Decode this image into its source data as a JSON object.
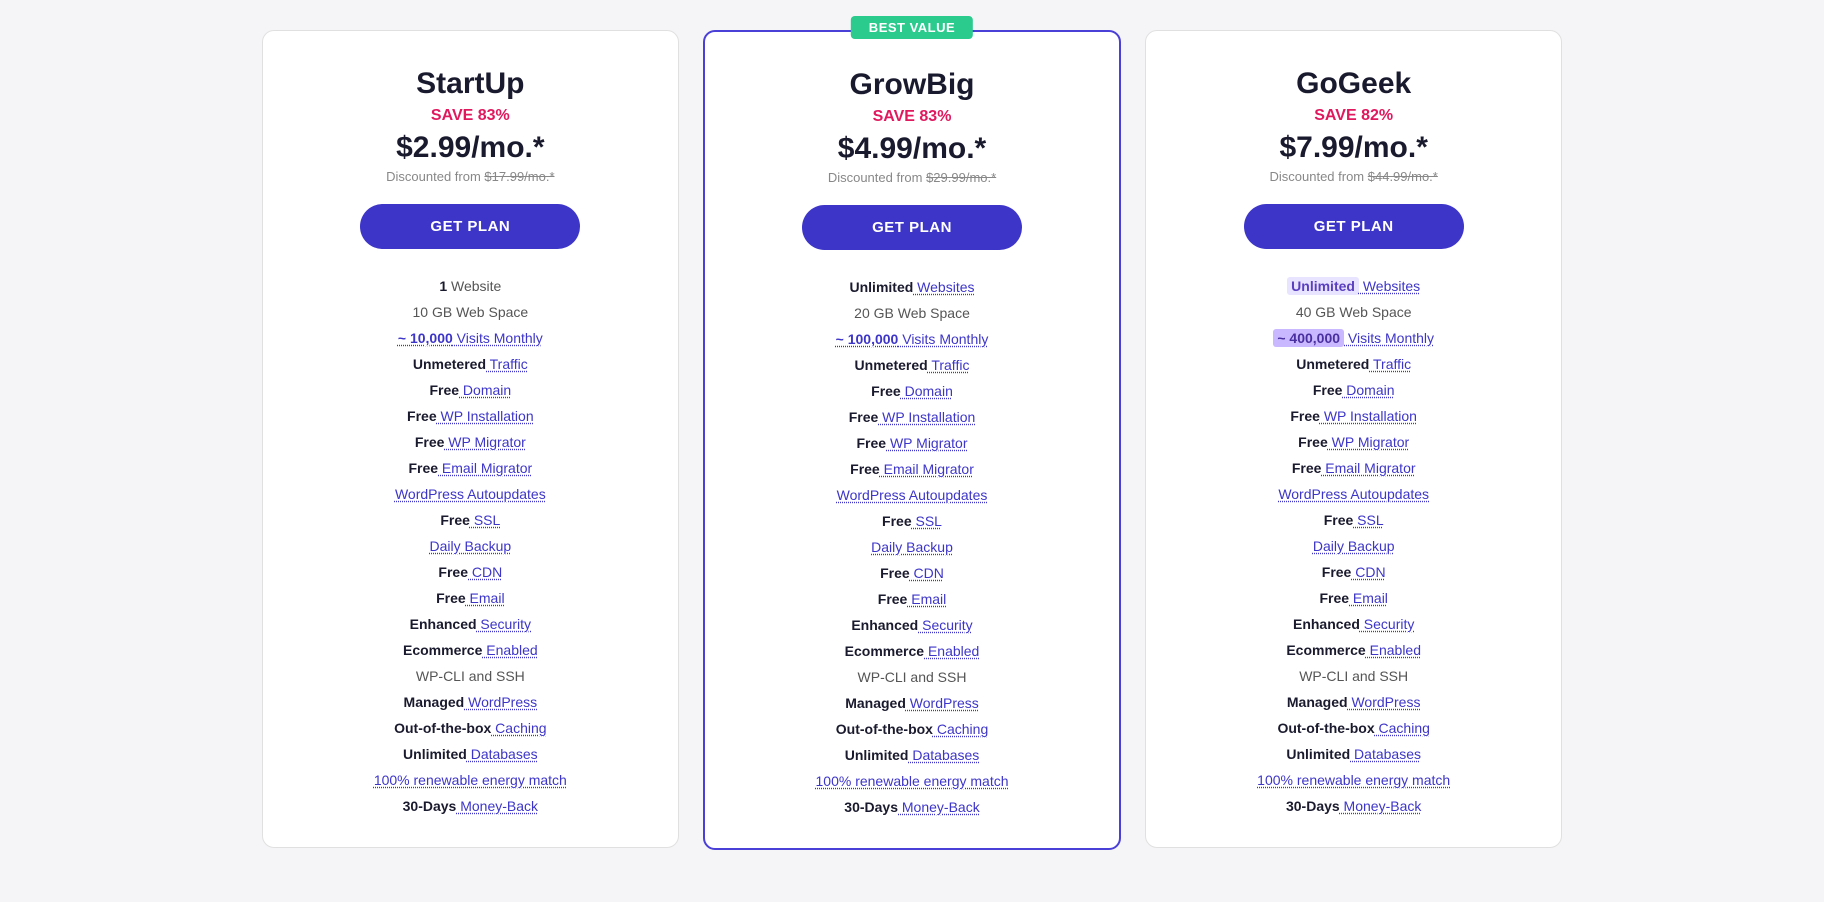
{
  "plans": [
    {
      "id": "startup",
      "name": "StartUp",
      "save": "SAVE 83%",
      "price": "$2.99/mo.*",
      "originalLabel": "Discounted from",
      "originalPrice": "$17.99/mo.*",
      "cta": "GET PLAN",
      "featured": false,
      "features": [
        {
          "bold": "1",
          "rest": " Website",
          "type": "normal"
        },
        {
          "bold": "",
          "rest": "10 GB Web Space",
          "type": "normal"
        },
        {
          "bold": "~ 10,000",
          "rest": " Visits Monthly",
          "type": "link-rest"
        },
        {
          "bold": "Unmetered",
          "rest": " Traffic",
          "type": "bold-link"
        },
        {
          "bold": "Free",
          "rest": " Domain",
          "type": "bold-link"
        },
        {
          "bold": "Free",
          "rest": " WP Installation",
          "type": "bold-link"
        },
        {
          "bold": "Free",
          "rest": " WP Migrator",
          "type": "bold-link"
        },
        {
          "bold": "Free",
          "rest": " Email Migrator",
          "type": "bold-link"
        },
        {
          "bold": "",
          "rest": "WordPress Autoupdates",
          "type": "link-all"
        },
        {
          "bold": "Free",
          "rest": " SSL",
          "type": "bold-link"
        },
        {
          "bold": "",
          "rest": "Daily Backup",
          "type": "link-all"
        },
        {
          "bold": "Free",
          "rest": " CDN",
          "type": "bold-link"
        },
        {
          "bold": "Free",
          "rest": " Email",
          "type": "bold-link"
        },
        {
          "bold": "Enhanced",
          "rest": " Security",
          "type": "bold-link"
        },
        {
          "bold": "Ecommerce",
          "rest": " Enabled",
          "type": "bold-link"
        },
        {
          "bold": "",
          "rest": "WP-CLI and SSH",
          "type": "normal"
        },
        {
          "bold": "Managed",
          "rest": " WordPress",
          "type": "bold-link"
        },
        {
          "bold": "Out-of-the-box",
          "rest": " Caching",
          "type": "bold-link"
        },
        {
          "bold": "Unlimited",
          "rest": " Databases",
          "type": "bold-link"
        },
        {
          "bold": "",
          "rest": "100% renewable energy match",
          "type": "link-all"
        },
        {
          "bold": "30-Days",
          "rest": " Money-Back",
          "type": "bold-link"
        }
      ]
    },
    {
      "id": "growbig",
      "name": "GrowBig",
      "save": "SAVE 83%",
      "price": "$4.99/mo.*",
      "originalLabel": "Discounted from",
      "originalPrice": "$29.99/mo.*",
      "cta": "GET PLAN",
      "featured": true,
      "badgeText": "BEST VALUE",
      "features": [
        {
          "bold": "Unlimited",
          "rest": " Websites",
          "type": "bold-link"
        },
        {
          "bold": "",
          "rest": "20 GB Web Space",
          "type": "normal"
        },
        {
          "bold": "~ 100,000",
          "rest": " Visits Monthly",
          "type": "link-rest"
        },
        {
          "bold": "Unmetered",
          "rest": " Traffic",
          "type": "bold-link"
        },
        {
          "bold": "Free",
          "rest": " Domain",
          "type": "bold-link"
        },
        {
          "bold": "Free",
          "rest": " WP Installation",
          "type": "bold-link"
        },
        {
          "bold": "Free",
          "rest": " WP Migrator",
          "type": "bold-link"
        },
        {
          "bold": "Free",
          "rest": " Email Migrator",
          "type": "bold-link"
        },
        {
          "bold": "",
          "rest": "WordPress Autoupdates",
          "type": "link-all"
        },
        {
          "bold": "Free",
          "rest": " SSL",
          "type": "bold-link"
        },
        {
          "bold": "",
          "rest": "Daily Backup",
          "type": "link-all"
        },
        {
          "bold": "Free",
          "rest": " CDN",
          "type": "bold-link"
        },
        {
          "bold": "Free",
          "rest": " Email",
          "type": "bold-link"
        },
        {
          "bold": "Enhanced",
          "rest": " Security",
          "type": "bold-link"
        },
        {
          "bold": "Ecommerce",
          "rest": " Enabled",
          "type": "bold-link"
        },
        {
          "bold": "",
          "rest": "WP-CLI and SSH",
          "type": "normal"
        },
        {
          "bold": "Managed",
          "rest": " WordPress",
          "type": "bold-link"
        },
        {
          "bold": "Out-of-the-box",
          "rest": " Caching",
          "type": "bold-link"
        },
        {
          "bold": "Unlimited",
          "rest": " Databases",
          "type": "bold-link"
        },
        {
          "bold": "",
          "rest": "100% renewable energy match",
          "type": "link-all"
        },
        {
          "bold": "30-Days",
          "rest": " Money-Back",
          "type": "bold-link"
        }
      ]
    },
    {
      "id": "gogeek",
      "name": "GoGeek",
      "save": "SAVE 82%",
      "price": "$7.99/mo.*",
      "originalLabel": "Discounted from",
      "originalPrice": "$44.99/mo.*",
      "cta": "GET PLAN",
      "featured": false,
      "features": [
        {
          "bold": "Unlimited",
          "rest": " Websites",
          "type": "highlight-bold",
          "highlight": true
        },
        {
          "bold": "",
          "rest": "40 GB Web Space",
          "type": "normal"
        },
        {
          "bold": "~ 400,000",
          "rest": " Visits Monthly",
          "type": "highlight-visits"
        },
        {
          "bold": "Unmetered",
          "rest": " Traffic",
          "type": "bold-link"
        },
        {
          "bold": "Free",
          "rest": " Domain",
          "type": "bold-link"
        },
        {
          "bold": "Free",
          "rest": " WP Installation",
          "type": "bold-link"
        },
        {
          "bold": "Free",
          "rest": " WP Migrator",
          "type": "bold-link"
        },
        {
          "bold": "Free",
          "rest": " Email Migrator",
          "type": "bold-link"
        },
        {
          "bold": "",
          "rest": "WordPress Autoupdates",
          "type": "link-all"
        },
        {
          "bold": "Free",
          "rest": " SSL",
          "type": "bold-link"
        },
        {
          "bold": "",
          "rest": "Daily Backup",
          "type": "link-all"
        },
        {
          "bold": "Free",
          "rest": " CDN",
          "type": "bold-link"
        },
        {
          "bold": "Free",
          "rest": " Email",
          "type": "bold-link"
        },
        {
          "bold": "Enhanced",
          "rest": " Security",
          "type": "bold-link"
        },
        {
          "bold": "Ecommerce",
          "rest": " Enabled",
          "type": "bold-link"
        },
        {
          "bold": "",
          "rest": "WP-CLI and SSH",
          "type": "normal"
        },
        {
          "bold": "Managed",
          "rest": " WordPress",
          "type": "bold-link"
        },
        {
          "bold": "Out-of-the-box",
          "rest": " Caching",
          "type": "bold-link"
        },
        {
          "bold": "Unlimited",
          "rest": " Databases",
          "type": "bold-link"
        },
        {
          "bold": "",
          "rest": "100% renewable energy match",
          "type": "link-all"
        },
        {
          "bold": "30-Days",
          "rest": " Money-Back",
          "type": "bold-link"
        }
      ]
    }
  ]
}
